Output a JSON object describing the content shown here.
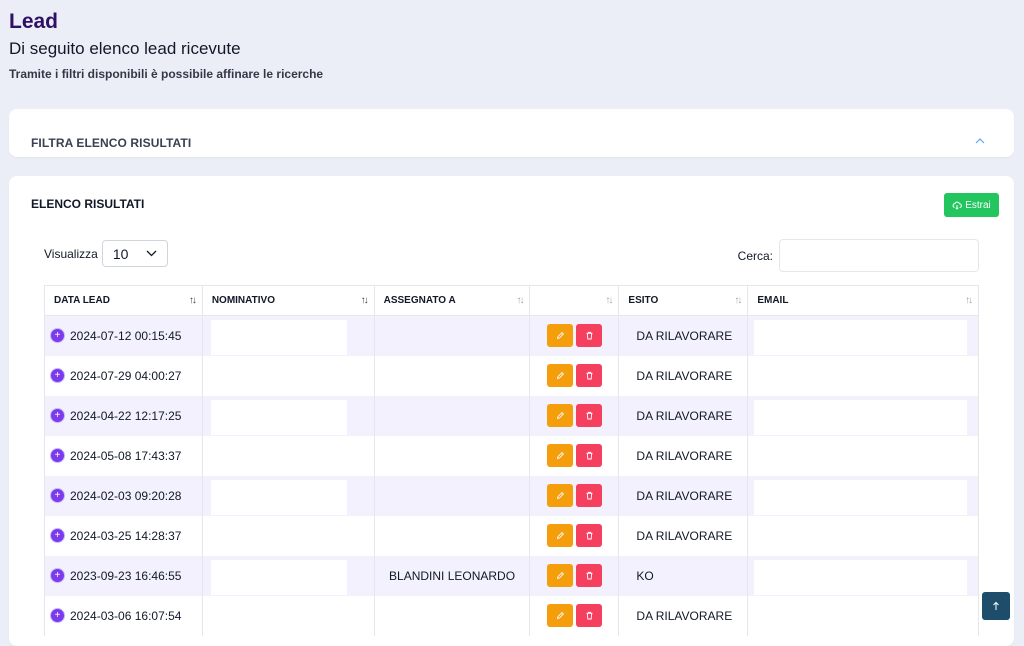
{
  "header": {
    "title": "Lead",
    "subtitle": "Di seguito elenco lead ricevute",
    "description": "Tramite i filtri disponibili è possibile affinare le ricerche"
  },
  "filter": {
    "title": "FILTRA ELENCO RISULTATI",
    "icon": "chevron-up-icon"
  },
  "results": {
    "title": "ELENCO RISULTATI",
    "export_label": "Estrai",
    "length_label": "Visualizza",
    "length_value": "10",
    "search_label": "Cerca:",
    "search_value": "",
    "columns": [
      "DATA LEAD",
      "NOMINATIVO",
      "ASSEGNATO A",
      "",
      "ESITO",
      "EMAIL"
    ],
    "rows": [
      {
        "date": "2024-07-12 00:15:45",
        "assigned": "",
        "esito": "DA RILAVORARE"
      },
      {
        "date": "2024-07-29 04:00:27",
        "assigned": "",
        "esito": "DA RILAVORARE"
      },
      {
        "date": "2024-04-22 12:17:25",
        "assigned": "",
        "esito": "DA RILAVORARE"
      },
      {
        "date": "2024-05-08 17:43:37",
        "assigned": "",
        "esito": "DA RILAVORARE"
      },
      {
        "date": "2024-02-03 09:20:28",
        "assigned": "",
        "esito": "DA RILAVORARE"
      },
      {
        "date": "2024-03-25 14:28:37",
        "assigned": "",
        "esito": "DA RILAVORARE"
      },
      {
        "date": "2023-09-23 16:46:55",
        "assigned": "BLANDINI LEONARDO",
        "esito": "KO"
      },
      {
        "date": "2024-03-06 16:07:54",
        "assigned": "",
        "esito": "DA RILAVORARE"
      }
    ]
  },
  "colors": {
    "accent": "#7c3aed",
    "title": "#2e1065",
    "export": "#22c55e",
    "edit": "#f59e0b",
    "delete": "#f43f5e",
    "scroll_top": "#1e4d6b"
  }
}
